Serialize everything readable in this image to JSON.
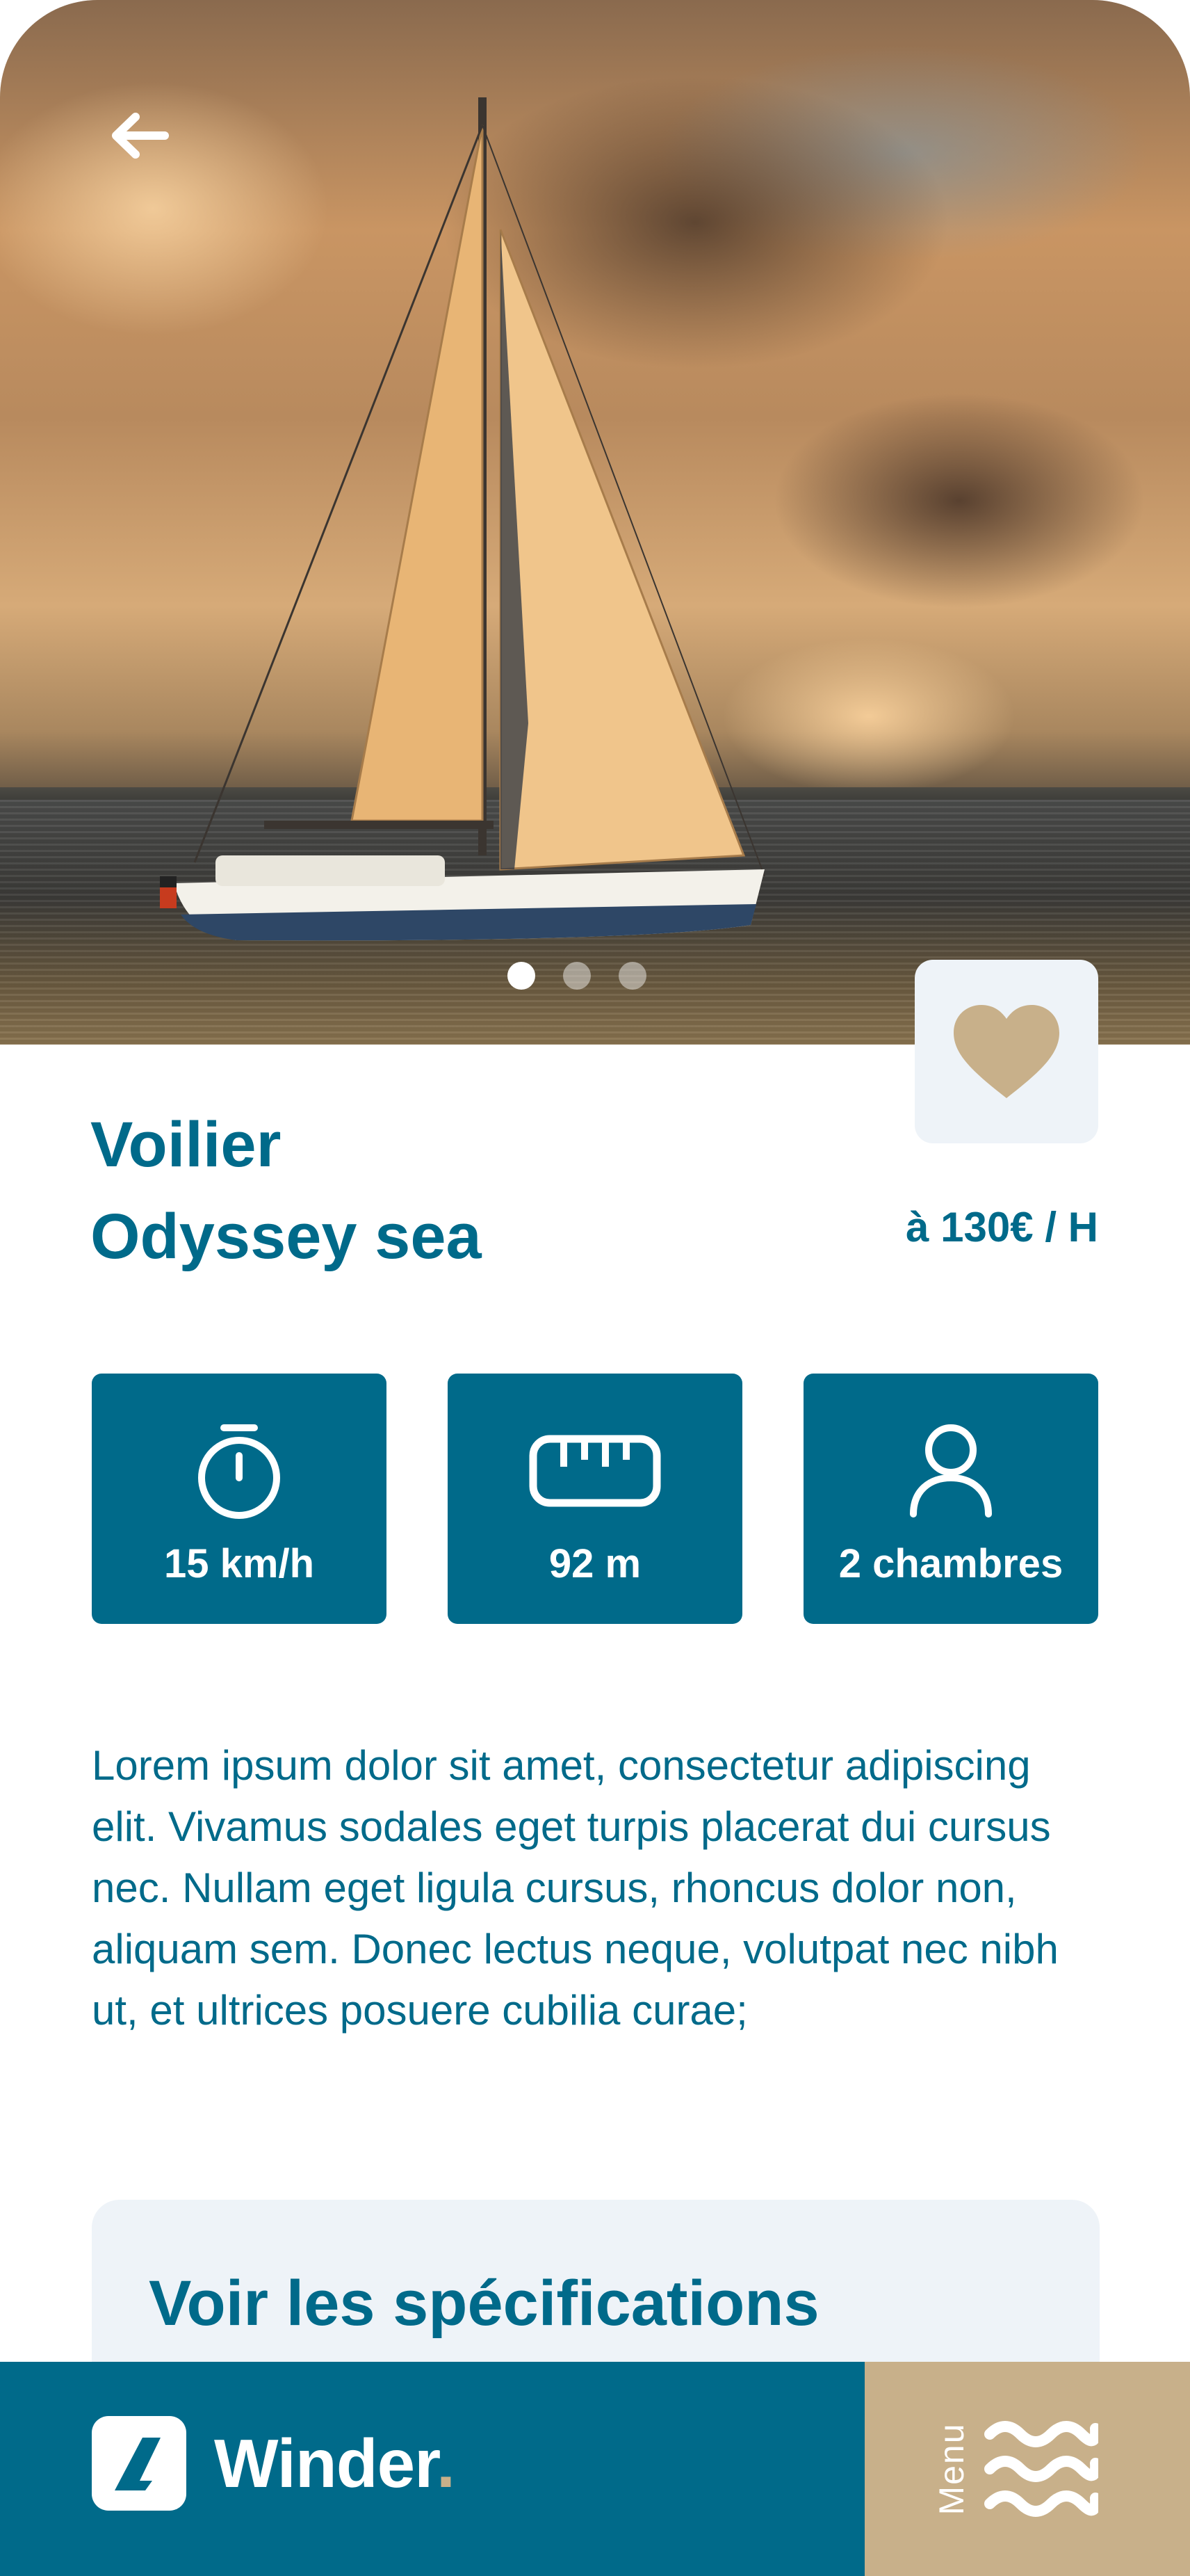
{
  "hero": {
    "image_alt": "Sailboat on the sea at sunset",
    "carousel_count": 3,
    "carousel_active_index": 0
  },
  "boat": {
    "type_label": "Voilier",
    "name": "Odyssey sea",
    "price": "à 130€ / H"
  },
  "features": [
    {
      "icon": "stopwatch-icon",
      "label": "15 km/h"
    },
    {
      "icon": "ruler-icon",
      "label": "92 m"
    },
    {
      "icon": "person-icon",
      "label": "2 chambres"
    }
  ],
  "description": "Lorem ipsum dolor sit amet, consectetur adipiscing elit. Vivamus sodales eget turpis placerat dui cursus nec. Nullam eget ligula cursus, rhoncus dolor non, aliquam sem. Donec lectus neque, volutpat nec nibh ut, et ultrices posuere cubilia curae;",
  "specs_button": "Voir les spécifications",
  "bottom_nav": {
    "brand_name": "Winder",
    "brand_dot": ".",
    "menu_label": "Menu"
  },
  "colors": {
    "primary": "#006A8A",
    "accent": "#C8B08A",
    "light": "#EEF3F8"
  }
}
